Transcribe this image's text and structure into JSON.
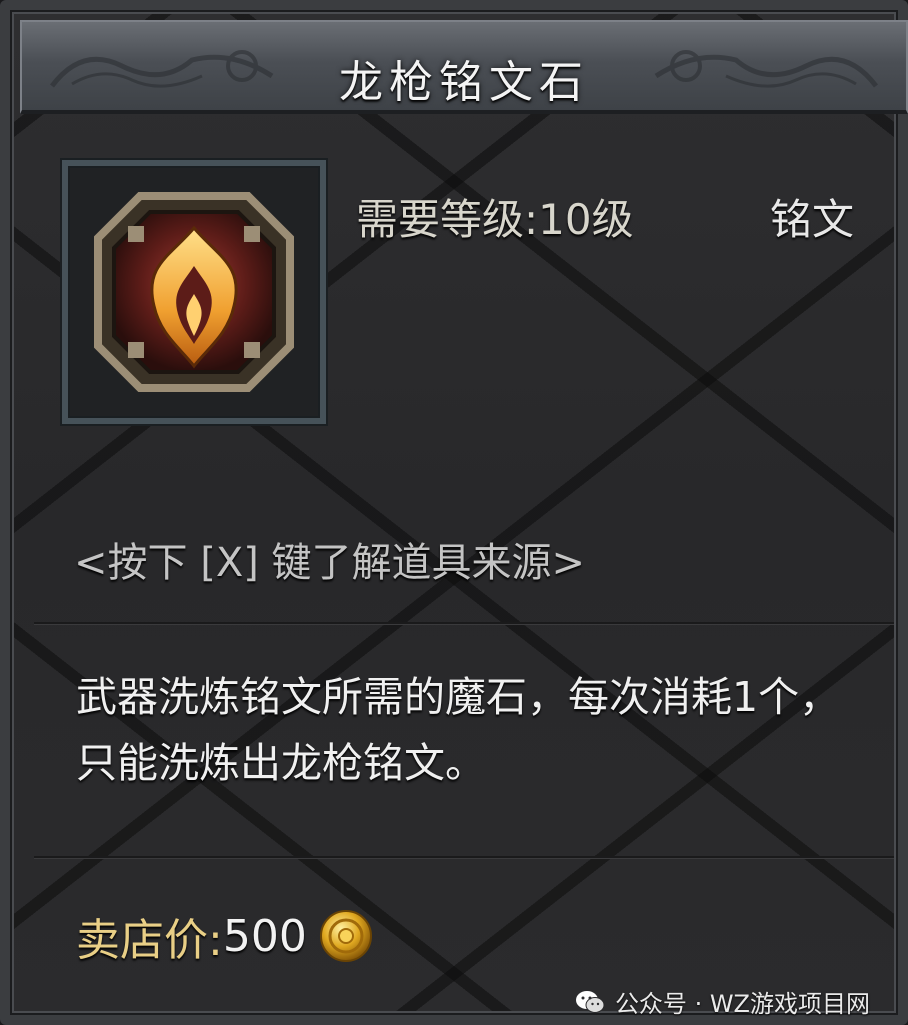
{
  "item": {
    "name": "龙枪铭文石",
    "required_level": "需要等级:10级",
    "type": "铭文",
    "source_hint": "<按下 [X] 键了解道具来源>",
    "description": "武器洗炼铭文所需的魔石，每次消耗1个，只能洗炼出龙枪铭文。",
    "sell_price_label": "卖店价:",
    "sell_price_value": "500",
    "icon": "flame-rune-stone-icon",
    "currency_icon": "gold-coin-icon"
  },
  "watermark": {
    "icon": "wechat-icon",
    "text": "公众号 · WZ游戏项目网"
  },
  "colors": {
    "price_label": "#e9cf86",
    "title_text": "#f4f4f4",
    "rune_flame": "#f0b040"
  }
}
